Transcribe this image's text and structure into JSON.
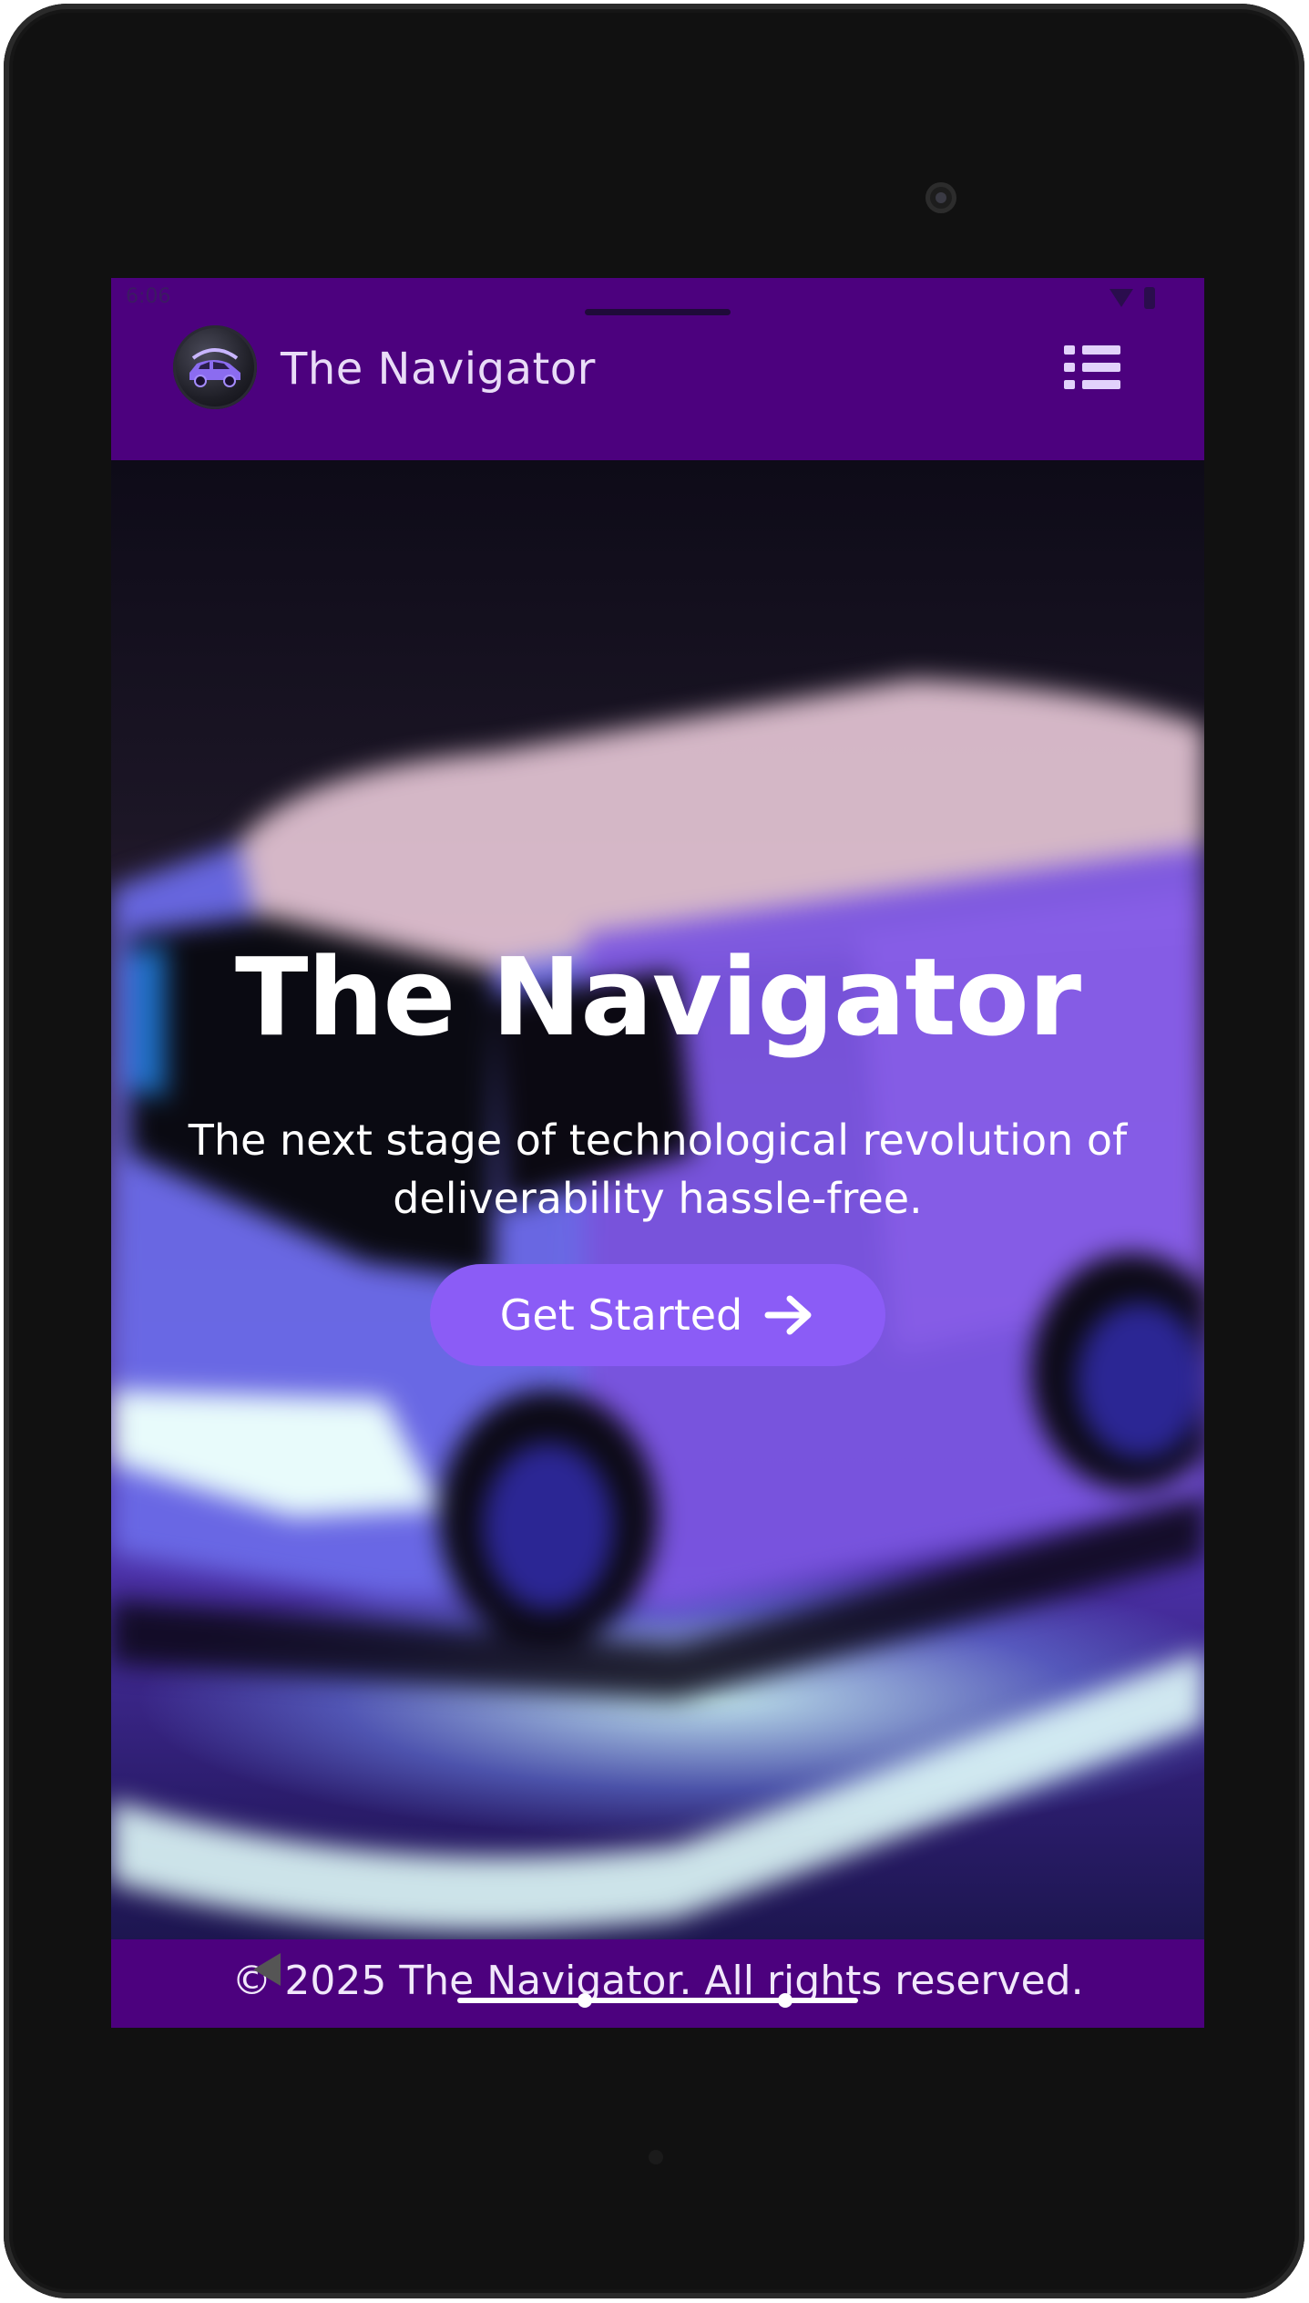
{
  "status_bar": {
    "time": "6:06",
    "icons": [
      "wifi-icon",
      "battery-icon"
    ]
  },
  "header": {
    "logo": "car-logo-icon",
    "title": "The Navigator",
    "menu_icon": "list-menu-icon"
  },
  "hero": {
    "title": "The Navigator",
    "subtitle": "The next stage of technological revolution of deliverability hassle-free.",
    "cta_label": "Get Started",
    "cta_icon": "arrow-right-icon",
    "background_image": "blurred-delivery-van"
  },
  "footer": {
    "text": "© 2025 The Navigator. All rights reserved."
  },
  "colors": {
    "header_bg": "#4c017e",
    "cta_bg": "#8b5cf6",
    "text_light": "#ffffff"
  }
}
